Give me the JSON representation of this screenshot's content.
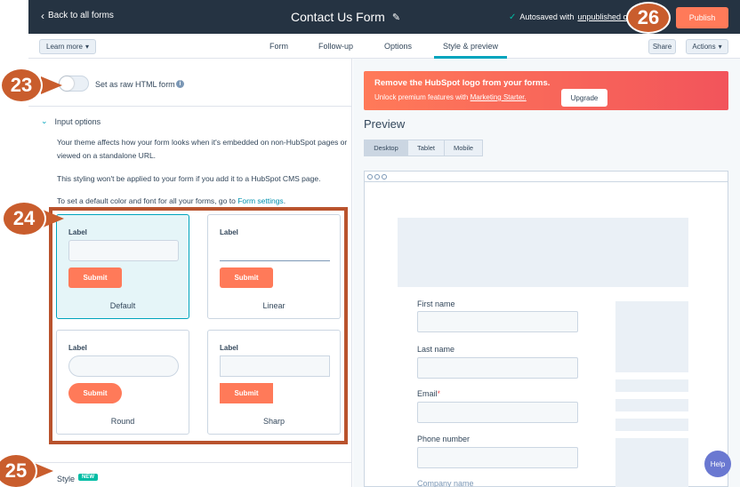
{
  "topbar": {
    "back_label": "Back to all forms",
    "title": "Contact Us Form",
    "autosave_text": "Autosaved with",
    "autosave_link": "unpublished c",
    "publish_label": "Publish"
  },
  "nav": {
    "learn_more": "Learn more",
    "tabs": [
      "Form",
      "Follow-up",
      "Options",
      "Style & preview"
    ],
    "share": "Share",
    "actions": "Actions"
  },
  "left": {
    "raw_html_label": "Set as raw HTML form",
    "input_options_label": "Input options",
    "para1": "Your theme affects how your form looks when it's embedded on non-HubSpot pages or viewed on a standalone URL.",
    "para2": "This styling won't be applied to your form if you add it to a HubSpot CMS page.",
    "para3_prefix": "To set a default color and font for all your forms, go to",
    "para3_link": "Form settings",
    "para3_suffix": ".",
    "styles": [
      {
        "label": "Label",
        "button": "Submit",
        "name": "Default"
      },
      {
        "label": "Label",
        "button": "Submit",
        "name": "Linear"
      },
      {
        "label": "Label",
        "button": "Submit",
        "name": "Round"
      },
      {
        "label": "Label",
        "button": "Submit",
        "name": "Sharp"
      }
    ],
    "style_label": "Style",
    "new_badge": "NEW"
  },
  "right": {
    "banner_title": "Remove the HubSpot logo from your forms.",
    "banner_text": "Unlock premium features with",
    "banner_link": "Marketing Starter.",
    "upgrade": "Upgrade",
    "preview_title": "Preview",
    "devices": [
      "Desktop",
      "Tablet",
      "Mobile"
    ],
    "fields": [
      "First name",
      "Last name",
      "Email",
      "Phone number",
      "Company name"
    ],
    "required_mark": "*"
  },
  "help_label": "Help",
  "callouts": [
    "23",
    "24",
    "25",
    "26"
  ],
  "colors": {
    "accent": "#ff7a59",
    "topbar": "#253342",
    "teal": "#00a4bd",
    "callout": "#c95d2d"
  }
}
